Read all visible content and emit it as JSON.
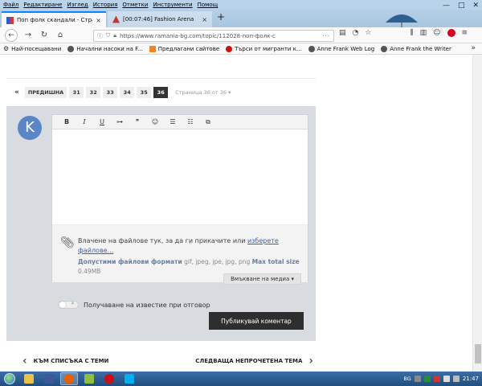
{
  "browser": {
    "menu": [
      "Файл",
      "Редактиране",
      "Изглед",
      "История",
      "Отметки",
      "Инструменти",
      "Помощ"
    ],
    "tabs": [
      {
        "title": "Поп фолк скандали - Страни",
        "close": "×"
      },
      {
        "title": "[00:07:46] Fashion Arena",
        "close": "×"
      }
    ],
    "new_tab": "+",
    "window_controls": {
      "minimize": "—",
      "maximize": "□",
      "close": "✕"
    },
    "url": "https://www.ramania-bg.com/topic/112028-поп-фолк-с",
    "url_more": "···",
    "bookmarks": [
      {
        "label": "Най-посещавани",
        "icon": "star"
      },
      {
        "label": "Начални насоки на F...",
        "icon": "globe"
      },
      {
        "label": "Предлагани сайтове",
        "icon": "orange"
      },
      {
        "label": "Търси от мигранти к...",
        "icon": "red"
      },
      {
        "label": "Anne Frank Web Log",
        "icon": "globe"
      },
      {
        "label": "Anne Frank the Writer",
        "icon": "globe"
      }
    ],
    "bookmarks_more": "»"
  },
  "pagination": {
    "first": "«",
    "prev": "ПРЕДИШНА",
    "pages": [
      "31",
      "32",
      "33",
      "34",
      "35",
      "36"
    ],
    "current": "36",
    "info": "Страница 36 от 36 ▾"
  },
  "reply": {
    "avatar_letter": "K",
    "toolbar": [
      "B",
      "I",
      "U",
      "⊶",
      "❞",
      "☺",
      "☰",
      "☷",
      "⧉"
    ],
    "attach_text": "Влачене на файлове тук, за да ги прикачите или ",
    "attach_link": "изберете файлове...",
    "allowed_label": "Допустими файлови формати",
    "allowed_types": "gif, jpeg, jpe, jpg, png",
    "max_label": "Max total size",
    "max_size": "0.49MB",
    "media_button": "Вмъкване на медиа ▾",
    "notify_label": "Получаване на известие при отговор",
    "publish_button": "Публикувай коментар"
  },
  "bottom_nav": {
    "back_label": "КЪМ СПИСЪКА С ТЕМИ",
    "next_label": "СЛЕДВАЩА НЕПРОЧЕТЕНА ТЕМА"
  },
  "taskbar": {
    "lang": "BG",
    "time": "21:47"
  },
  "colors": {
    "reply_bg": "#d8dbe0",
    "avatar": "#5b86c6",
    "publish_bg": "#2e2e2e",
    "taskbar": "#214e80"
  }
}
